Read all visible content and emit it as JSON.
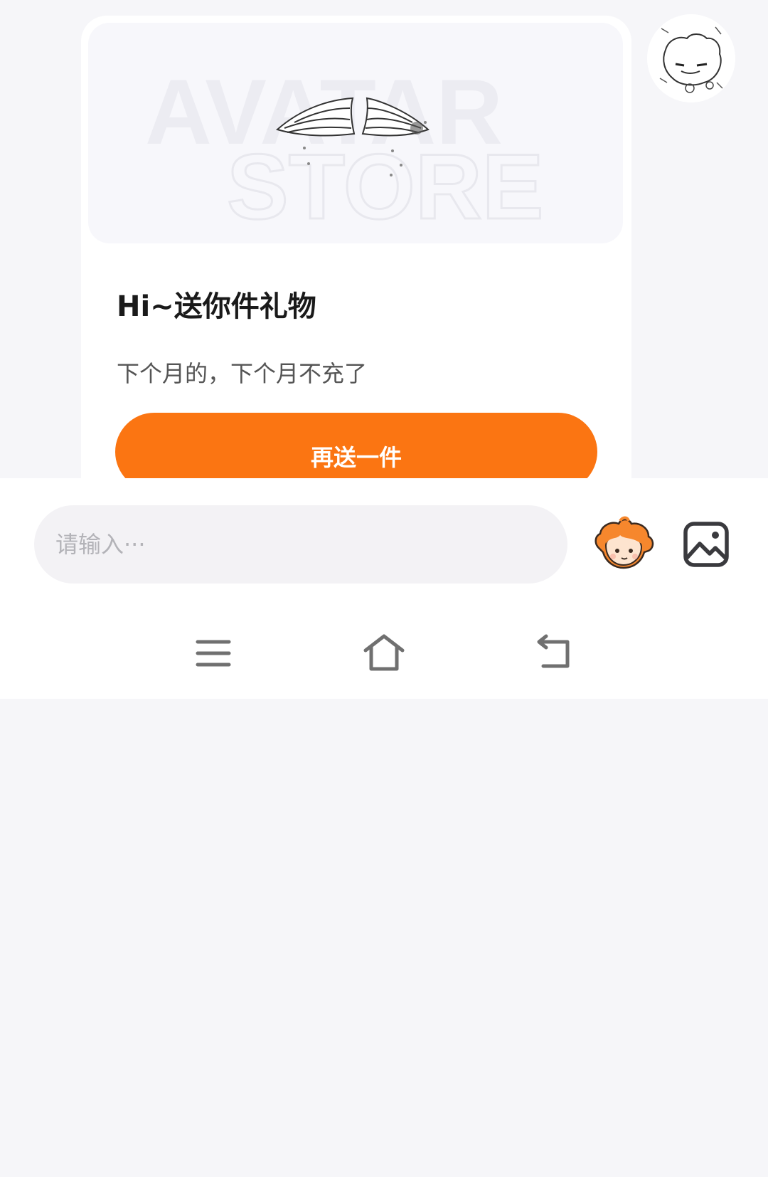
{
  "gift_card": {
    "image_text_top": "AVATAR",
    "image_text_bottom": "STORE",
    "title": "Hi~送你件礼物",
    "message": "下个月的，下个月不充了",
    "resend_label": "再送一件"
  },
  "composer": {
    "placeholder": "请输入···"
  },
  "icons": {
    "emoji": "anime-girl-emoji-icon",
    "image": "image-icon",
    "menu": "menu-icon",
    "home": "home-icon",
    "back": "back-icon"
  },
  "colors": {
    "accent": "#fb7512",
    "background": "#f6f6f9",
    "icon": "#3a3a3e"
  }
}
